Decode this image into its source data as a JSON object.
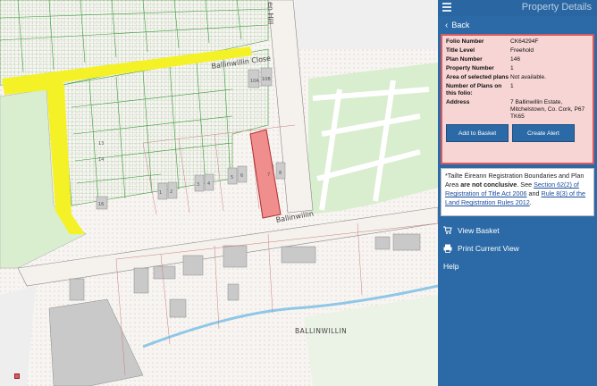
{
  "map": {
    "labels": {
      "close": "Ballinwillin Close",
      "hill": "en Hill",
      "road": "Ballinwillin",
      "town": "BALLINWILLIN"
    },
    "house_numbers": [
      "10A",
      "10B",
      "1",
      "2",
      "3",
      "4",
      "5",
      "6",
      "7",
      "8",
      "9",
      "10",
      "11",
      "12",
      "13",
      "14",
      "15",
      "16"
    ]
  },
  "panel": {
    "title": "Property Details",
    "back_label": "Back",
    "details": [
      {
        "key": "Folio Number",
        "value": "CK64294F"
      },
      {
        "key": "Title Level",
        "value": "Freehold"
      },
      {
        "key": "Plan Number",
        "value": "146"
      },
      {
        "key": "Property Number",
        "value": "1"
      },
      {
        "key": "Area of selected plans",
        "value": "Not available."
      },
      {
        "key": "Number of Plans on this folio:",
        "value": "1"
      },
      {
        "key": "Address",
        "value": "7 Ballinwillin Estate, Mitchelstown, Co. Cork, P67 TK65"
      }
    ],
    "add_to_basket": "Add to Basket",
    "create_alert": "Create Alert",
    "notice": {
      "prefix": "*Tailte Éireann Registration Boundaries and Plan Area ",
      "bold": "are not conclusive",
      "middle": ". See ",
      "link1": "Section 62(2) of Registration of Title Act 2006",
      "and": " and ",
      "link2": "Rule 8(3) of the Land Registration Rules 2012",
      "suffix": "."
    },
    "view_basket": "View Basket",
    "print_view": "Print Current View",
    "help": "Help"
  },
  "colors": {
    "panel_bg": "#2b6aa6",
    "highlight": "#f08d8d",
    "parcel_green": "#3a9a3a",
    "road_yellow": "#f4f226"
  }
}
